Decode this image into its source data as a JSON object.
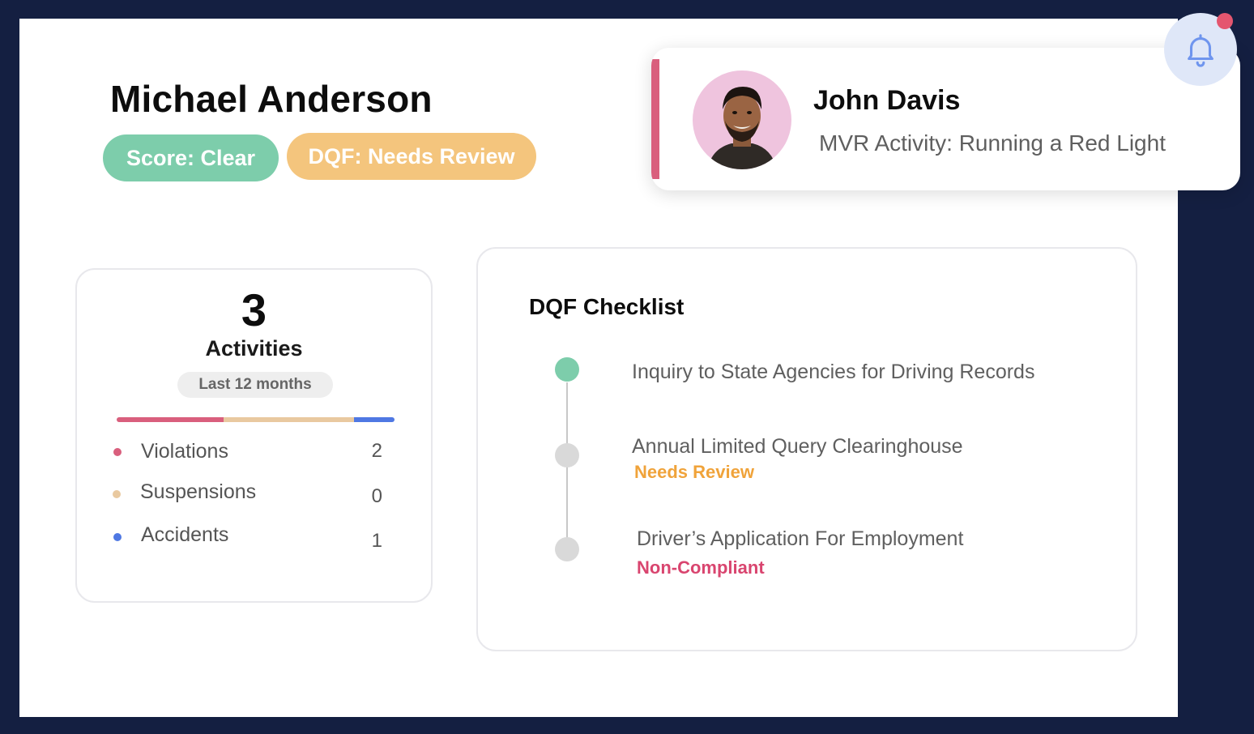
{
  "driver": {
    "name": "Michael Anderson",
    "score_badge": "Score: Clear",
    "dqf_badge": "DQF: Needs Review"
  },
  "colors": {
    "score_clear": "#7dcdab",
    "dqf_needs_review": "#f4c57d",
    "violations": "#d95f7d",
    "suspensions": "#e9c9a0",
    "accidents": "#4f78e3",
    "timeline_complete": "#7dcdab",
    "timeline_pending": "#d9d9d9",
    "needs_review_text": "#f0a33a",
    "non_compliant_text": "#d9456f"
  },
  "activities": {
    "count": "3",
    "label": "Activities",
    "period": "Last 12 months",
    "distribution": [
      {
        "key": "violations",
        "fraction": 0.385
      },
      {
        "key": "suspensions",
        "fraction": 0.47
      },
      {
        "key": "accidents",
        "fraction": 0.145
      }
    ],
    "items": [
      {
        "label": "Violations",
        "value": "2",
        "color": "#d95f7d"
      },
      {
        "label": "Suspensions",
        "value": "0",
        "color": "#e9c9a0"
      },
      {
        "label": "Accidents",
        "value": "1",
        "color": "#4f78e3"
      }
    ]
  },
  "checklist": {
    "title": "DQF Checklist",
    "items": [
      {
        "title": "Inquiry to State Agencies for Driving Records",
        "status": "",
        "state": "complete"
      },
      {
        "title": "Annual Limited Query Clearinghouse",
        "status": "Needs Review",
        "state": "pending"
      },
      {
        "title": "Driver’s Application For Employment",
        "status": "Non-Compliant",
        "state": "pending"
      }
    ]
  },
  "notification": {
    "name": "John Davis",
    "message": "MVR Activity: Running a Red Light",
    "icon": "bell-icon",
    "avatar": "person-avatar"
  }
}
